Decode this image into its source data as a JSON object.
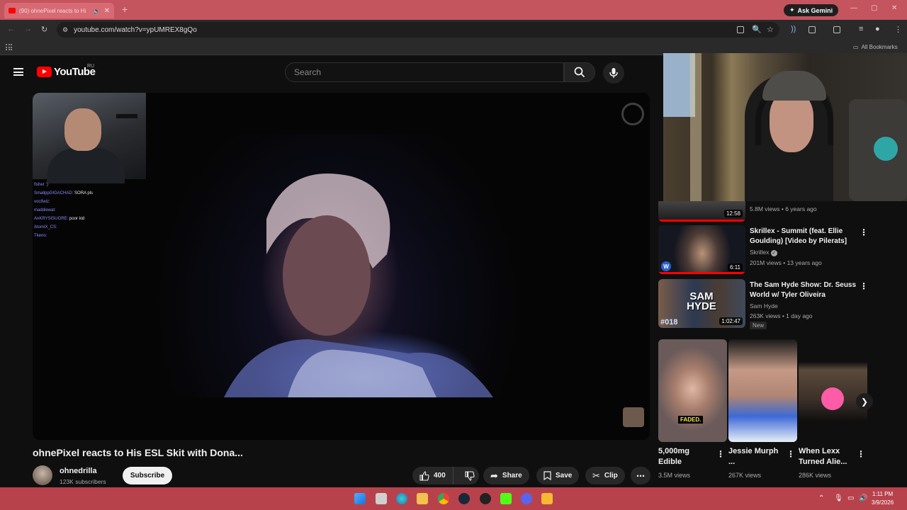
{
  "browser": {
    "tab_title": "(90) ohnePixel reacts to Hi",
    "url": "youtube.com/watch?v=ypUMREX8gQo",
    "ask_gemini": "Ask Gemini",
    "all_bookmarks": "All Bookmarks"
  },
  "youtube": {
    "logo_text": "YouTube",
    "region": "RU",
    "search_placeholder": "Search"
  },
  "player": {
    "chat": [
      {
        "user": "fisher :)",
        "msg": ""
      },
      {
        "user": "SmallppGIGACHAD:",
        "msg": "SORA pls"
      },
      {
        "user": "vocifwiz:",
        "msg": ""
      },
      {
        "user": "maddiewat:",
        "msg": ""
      },
      {
        "user": "AnKRYSISUGRE:",
        "msg": "poor kid"
      },
      {
        "user": "AtomiX_CS:",
        "msg": ""
      },
      {
        "user": "Tkeno:",
        "msg": ""
      }
    ]
  },
  "video": {
    "title": "ohnePixel reacts to His ESL Skit with Dona...",
    "channel": "ohnedrilla",
    "subscribers": "123K subscribers",
    "subscribe_label": "Subscribe",
    "likes": "400",
    "share_label": "Share",
    "save_label": "Save",
    "clip_label": "Clip"
  },
  "sidebar": {
    "partial": {
      "duration": "12:58",
      "meta": "5.8M views • 6 years ago"
    },
    "items": [
      {
        "title": "Skrillex - Summit (feat. Ellie Goulding) [Video by Pilerats]",
        "channel": "Skrillex",
        "meta": "201M views • 13 years ago",
        "duration": "6:11",
        "new": ""
      },
      {
        "title": "The Sam Hyde Show: Dr. Seuss World w/ Tyler Oliveira",
        "channel": "Sam Hyde",
        "meta": "263K views • 1 day ago",
        "duration": "1:02:47",
        "new": "New",
        "thumb_text": "SAM HYDE",
        "thumb_num": "#018"
      }
    ]
  },
  "shorts": [
    {
      "title": "5,000mg Edible",
      "views": "3.5M views",
      "caption": "FADED."
    },
    {
      "title": "Jessie Murph ...",
      "views": "267K views",
      "caption": ""
    },
    {
      "title": "When Lexx Turned Alie...",
      "views": "286K views",
      "caption": ""
    }
  ],
  "taskbar": {
    "time": "1:11 PM",
    "date": "3/9/2026"
  },
  "colors": {
    "tabbar": "#c4545e",
    "taskbar": "#b8424c",
    "yt_red": "#ff0000",
    "bg": "#0f0f0f"
  }
}
